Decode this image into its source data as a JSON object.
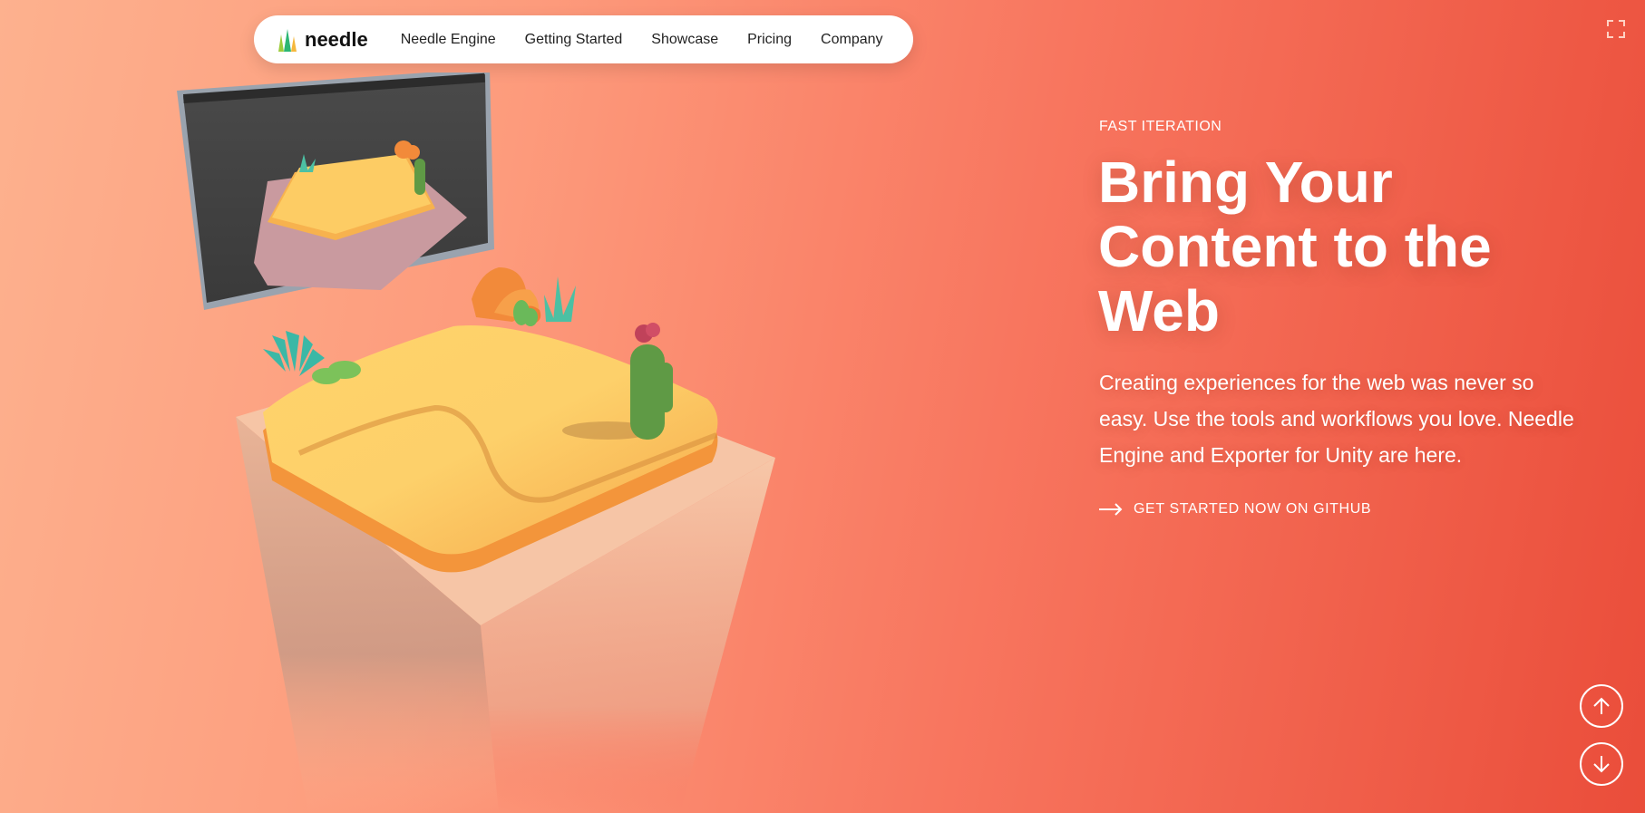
{
  "nav": {
    "logo_text": "needle",
    "links": [
      "Needle Engine",
      "Getting Started",
      "Showcase",
      "Pricing",
      "Company"
    ]
  },
  "hero": {
    "eyebrow": "FAST ITERATION",
    "headline": "Bring Your Content to the Web",
    "subtitle": "Creating experiences for the web was never so easy. Use the tools and workflows you love. Needle Engine and Exporter for Unity are here.",
    "cta_label": "GET STARTED NOW ON GITHUB"
  },
  "icons": {
    "fullscreen": "fullscreen-icon",
    "scroll_up": "arrow-up-icon",
    "scroll_down": "arrow-down-icon",
    "cta_arrow": "arrow-right-icon"
  },
  "colors": {
    "bg_left": "#fdb18e",
    "bg_right": "#ea4d3a",
    "nav_bg": "#ffffff",
    "text_light": "#ffffff"
  }
}
